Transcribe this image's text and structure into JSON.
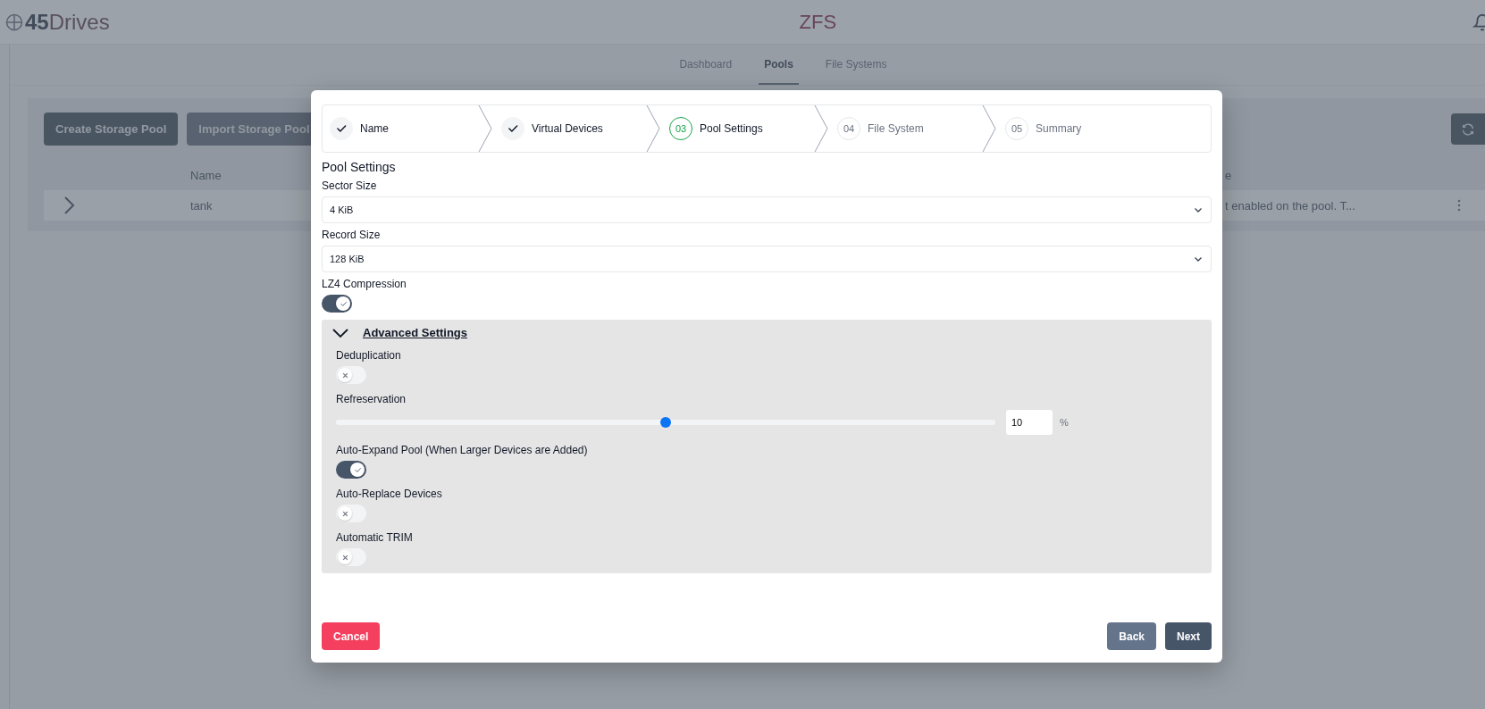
{
  "app": {
    "logo": "45Drives",
    "title": "ZFS"
  },
  "nav_tabs": [
    {
      "label": "Dashboard",
      "selected": false
    },
    {
      "label": "Pools",
      "selected": true
    },
    {
      "label": "File Systems",
      "selected": false
    }
  ],
  "toolbar": {
    "buttons": [
      "Create Storage Pool",
      "Import Storage Pool"
    ]
  },
  "table": {
    "columns": [
      "Name",
      "e"
    ],
    "rows": [
      {
        "cells": [
          "tank",
          "t enabled on the pool. T..."
        ]
      }
    ]
  },
  "dialog": {
    "steps": [
      {
        "label": "Name",
        "completed": true,
        "selected": false
      },
      {
        "label": "Virtual Devices",
        "completed": true,
        "selected": false
      },
      {
        "number": "03",
        "label": "Pool Settings",
        "completed": false,
        "selected": true
      },
      {
        "number": "04",
        "label": "File System",
        "completed": false,
        "selected": false
      },
      {
        "number": "05",
        "label": "Summary",
        "completed": false,
        "selected": false
      }
    ],
    "heading": "Pool Settings",
    "fields": [
      {
        "kind": "select",
        "label": "Sector Size",
        "value": "4 KiB"
      },
      {
        "kind": "select",
        "label": "Record Size",
        "value": "128 KiB"
      },
      {
        "kind": "toggle",
        "label": "LZ4 Compression",
        "on": true
      }
    ],
    "advanced": {
      "title": "Advanced Settings",
      "expanded": true,
      "fields": [
        {
          "kind": "toggle",
          "label": "Deduplication",
          "on": false
        },
        {
          "kind": "slider",
          "label": "Refreservation",
          "level": 0.5,
          "value": "10",
          "unit": "%"
        },
        {
          "kind": "toggle",
          "label": "Auto-Expand Pool (When Larger Devices are Added)",
          "on": true
        },
        {
          "kind": "toggle",
          "label": "Auto-Replace Devices",
          "on": false
        },
        {
          "kind": "toggle",
          "label": "Automatic TRIM",
          "on": false
        }
      ]
    },
    "buttons": [
      {
        "kind": "danger",
        "label": "Cancel"
      },
      {
        "kind": "secondary",
        "label": "Back"
      },
      {
        "kind": "primary",
        "label": "Next"
      }
    ]
  }
}
